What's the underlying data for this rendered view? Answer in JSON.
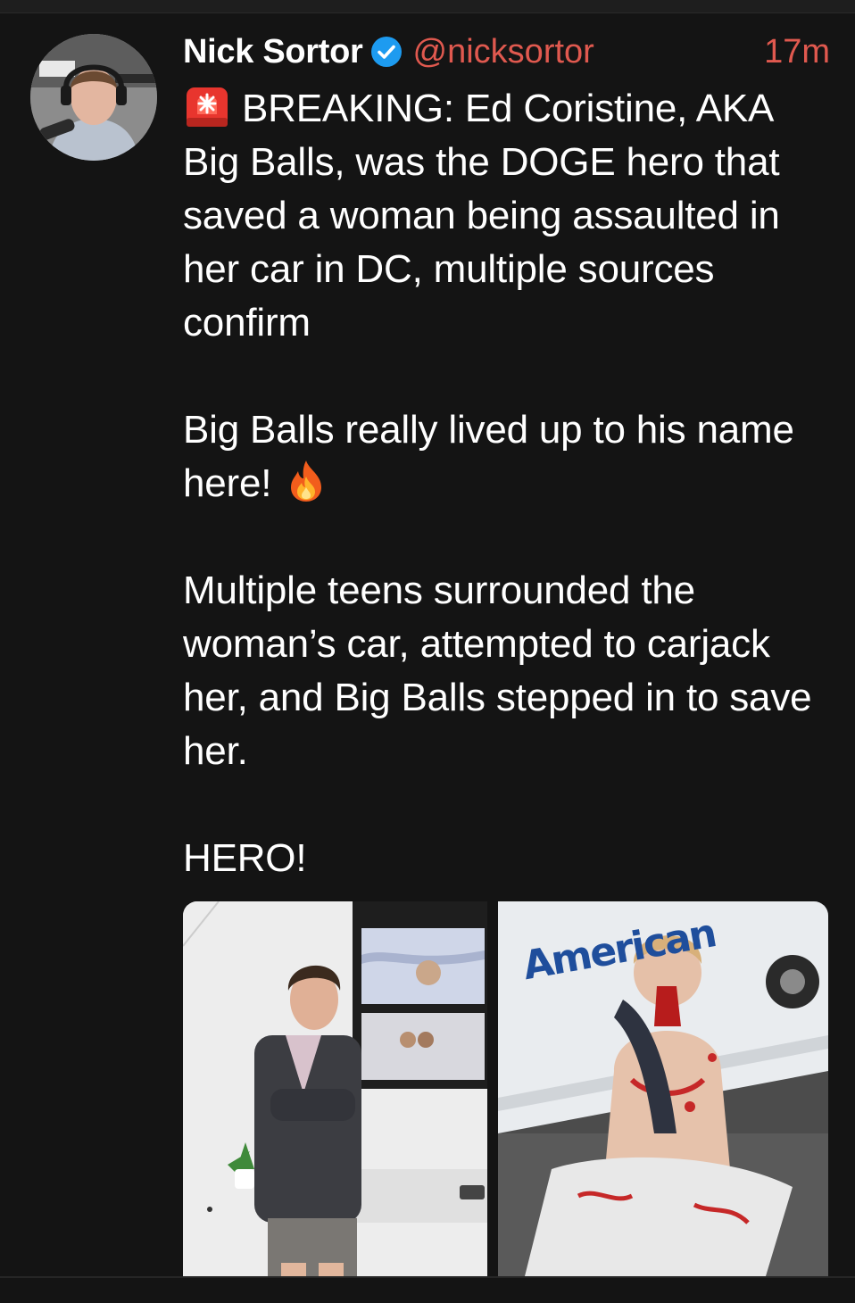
{
  "tweet": {
    "author": {
      "display_name": "Nick Sortor",
      "handle": "@nicksortor",
      "verified": true
    },
    "timestamp": "17m",
    "paragraphs": [
      {
        "icon": "rotating-light-icon",
        "text": "BREAKING: Ed Coristine, AKA Big Balls, was the DOGE hero that saved a woman being assaulted in her car in DC, multiple sources confirm"
      },
      {
        "text": "Big Balls really lived up to his name here!",
        "trailing_icon": "fire-icon"
      },
      {
        "text": "Multiple teens surrounded the woman’s car, attempted to carjack her, and Big Balls stepped in to save her."
      },
      {
        "text": "HERO!"
      }
    ],
    "media": [
      {
        "name": "photo-young-man-in-blazer"
      },
      {
        "name": "photo-injured-man-by-van",
        "visible_text": "American"
      }
    ]
  },
  "colors": {
    "background": "#141414",
    "text": "#ffffff",
    "accent": "#e0594f",
    "verified_badge": "#1d9bf0"
  }
}
